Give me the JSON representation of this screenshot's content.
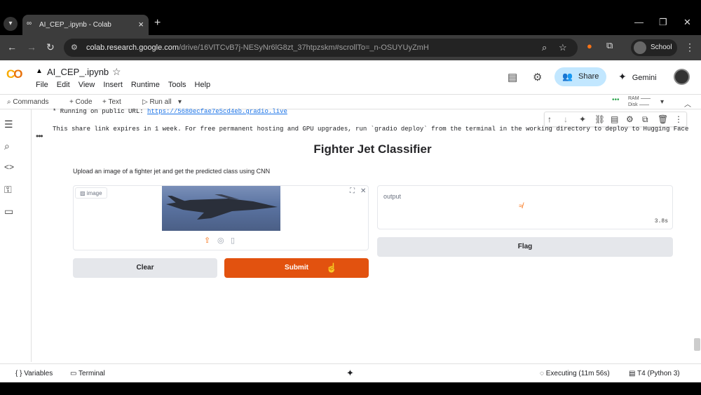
{
  "browser": {
    "tab_title": "AI_CEP_.ipynb - Colab",
    "url_host": "colab.research.google.com",
    "url_path": "/drive/16VlTCvB7j-NESyNr6lG8zt_37htpzskm#scrollTo=_n-OSUYUyZmH",
    "profile_label": "School"
  },
  "colab": {
    "notebook_title": "AI_CEP_.ipynb",
    "menu": [
      "File",
      "Edit",
      "View",
      "Insert",
      "Runtime",
      "Tools",
      "Help"
    ],
    "share_label": "Share",
    "gemini_label": "Gemini",
    "toolbar": {
      "commands": "Commands",
      "code": "+ Code",
      "text": "+ Text",
      "run_all": "Run all",
      "ram": "RAM",
      "disk": "Disk"
    }
  },
  "cell_output": {
    "running_prefix": "* Running on public URL: ",
    "public_url": "https://5680ecfae7e5cd4eb.gradio.live",
    "expiry_line": "This share link expires in 1 week. For free permanent hosting and GPU upgrades, run `gradio deploy` from the terminal in the working directory to deploy to Hugging Face"
  },
  "gradio_app": {
    "title": "Fighter Jet Classifier",
    "description": "Upload an image of a fighter jet and get the predicted class using CNN",
    "image_label": "image",
    "output_label": "output",
    "output_time": "3.8s",
    "flag_label": "Flag",
    "clear_label": "Clear",
    "submit_label": "Submit"
  },
  "status_bar": {
    "variables": "Variables",
    "terminal": "Terminal",
    "executing": "Executing (11m 56s)",
    "runtime": "T4 (Python 3)"
  },
  "colors": {
    "submit": "#e2520f",
    "share_bg": "#c2e7ff",
    "link": "#1a73e8"
  }
}
